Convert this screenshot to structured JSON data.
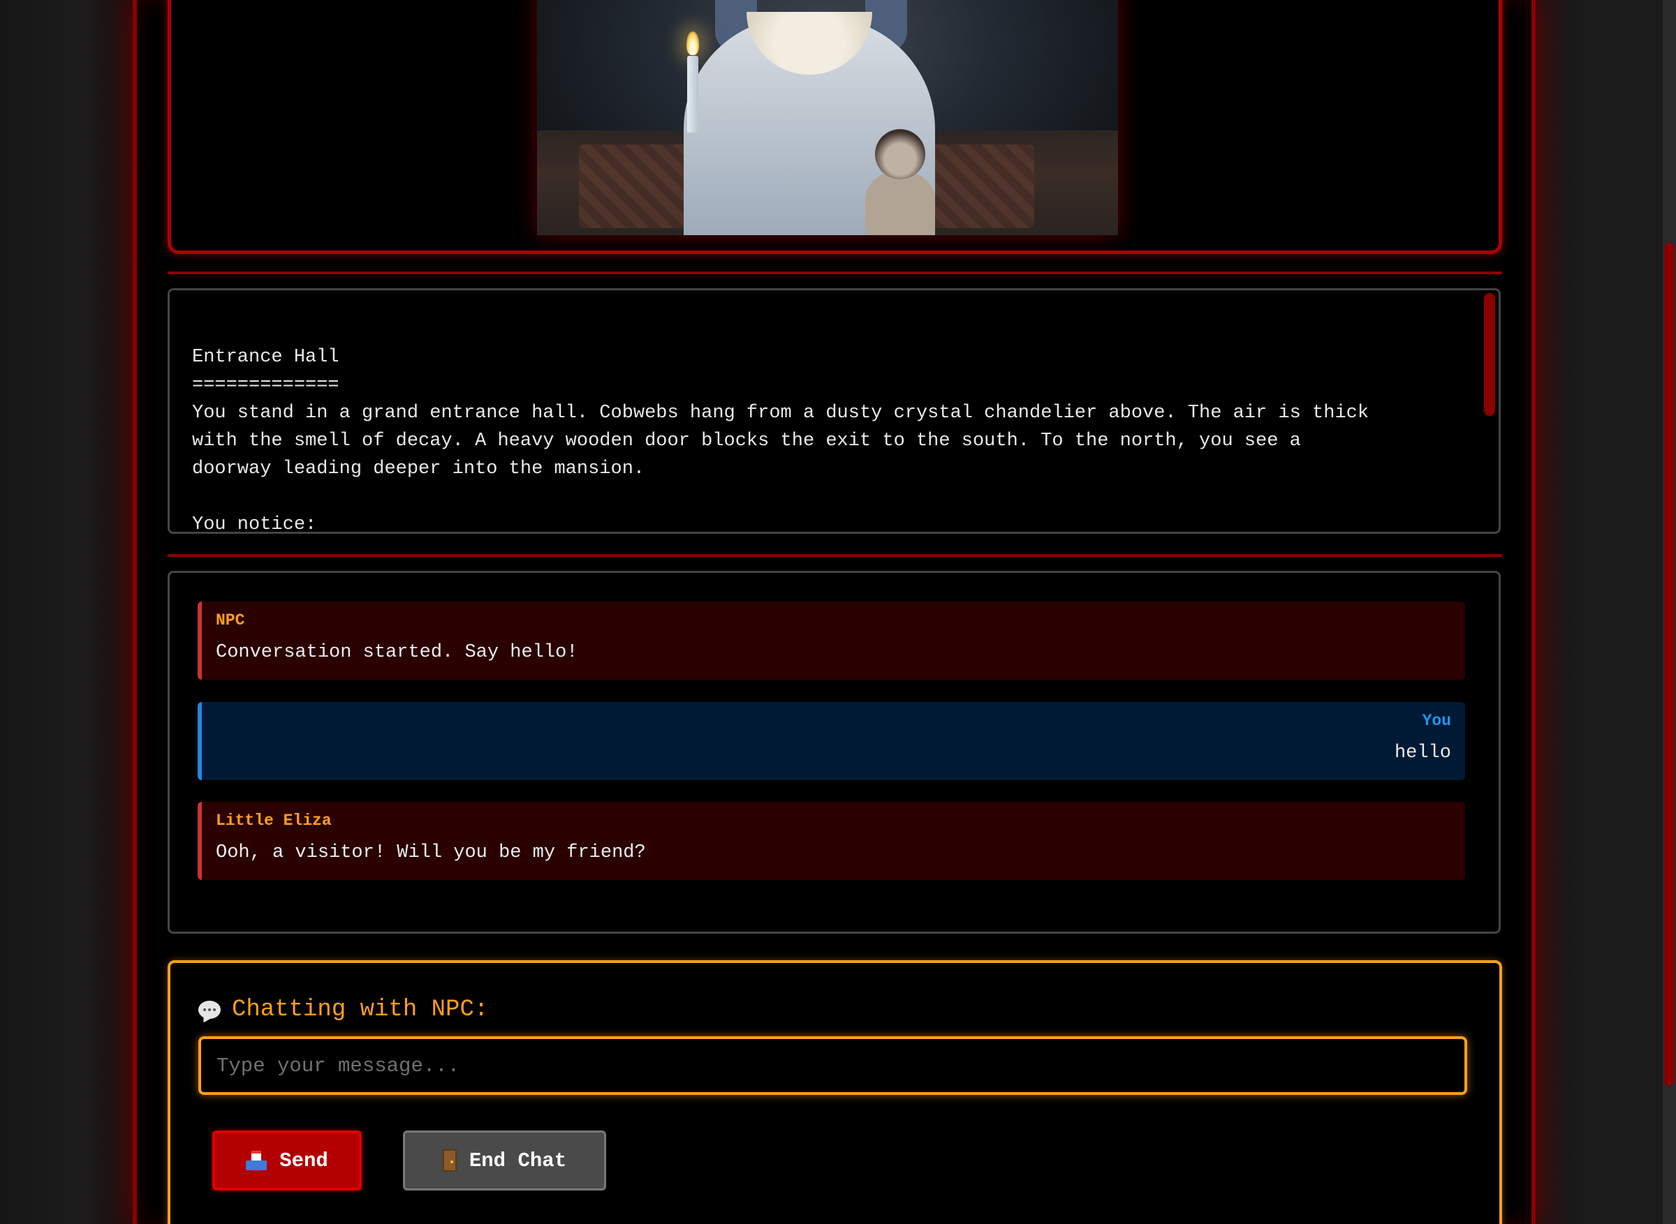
{
  "scene_image": {
    "alt": "Ghostly girl holding a candle with a doll in a dark mansion hall"
  },
  "room": {
    "text": "Entrance Hall\n=============\nYou stand in a grand entrance hall. Cobwebs hang from a dusty crystal chandelier above. The air is thick\nwith the smell of decay. A heavy wooden door blocks the exit to the south. To the north, you see a\ndoorway leading deeper into the mansion.\n\nYou notice:"
  },
  "chat": {
    "messages": [
      {
        "sender": "NPC",
        "text": "Conversation started. Say hello!",
        "role": "npc"
      },
      {
        "sender": "You",
        "text": "hello",
        "role": "you"
      },
      {
        "sender": "Little Eliza",
        "text": "Ooh, a visitor! Will you be my friend?",
        "role": "npc"
      }
    ],
    "title": "Chatting with NPC:",
    "placeholder": "Type your message...",
    "input_value": "",
    "send_label": "Send",
    "end_label": "End Chat"
  },
  "colors": {
    "accent_orange": "#ff9f1a",
    "blood_red": "#8b0000",
    "npc_bg": "#2a0000",
    "you_bg": "#001a36",
    "you_accent": "#1e88e5"
  },
  "icons": {
    "chat_title": "speech-bubble-icon",
    "send": "inbox-tray-icon",
    "end_chat": "door-icon"
  }
}
